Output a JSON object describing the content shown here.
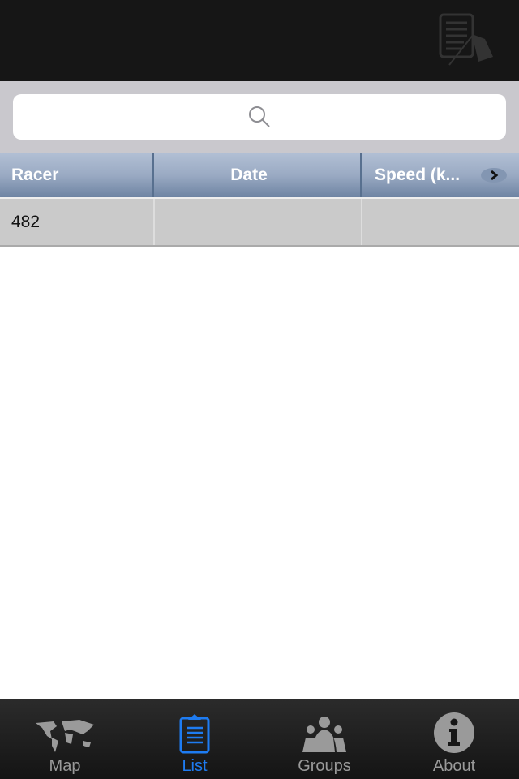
{
  "nav": {
    "icon": "checkered-flag-list-icon"
  },
  "search": {
    "placeholder": "",
    "icon": "search-icon"
  },
  "table": {
    "columns": [
      "Racer",
      "Date",
      "Speed (k..."
    ],
    "rows": [
      [
        "482",
        "",
        ""
      ]
    ],
    "scroll_icon": "chevron-right-icon"
  },
  "tabs": [
    {
      "label": "Map",
      "icon": "world-map-icon",
      "active": false
    },
    {
      "label": "List",
      "icon": "clipboard-list-icon",
      "active": true
    },
    {
      "label": "Groups",
      "icon": "people-icon",
      "active": false
    },
    {
      "label": "About",
      "icon": "info-icon",
      "active": false
    }
  ],
  "colors": {
    "accent": "#1e7cf2",
    "navbar": "#161616"
  }
}
